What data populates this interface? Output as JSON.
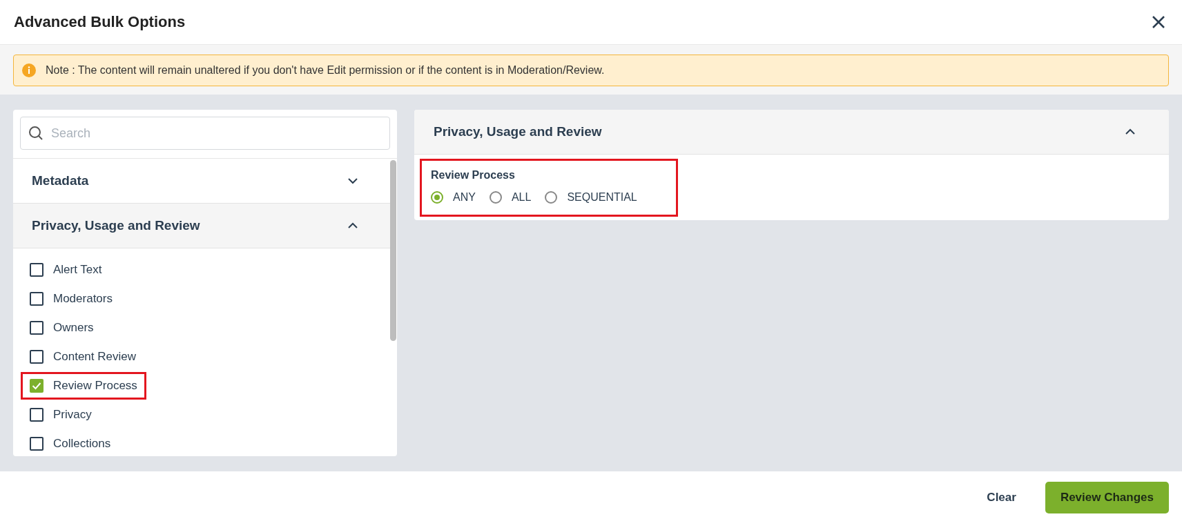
{
  "dialog": {
    "title": "Advanced Bulk Options"
  },
  "note": {
    "text": "Note : The content will remain unaltered if you don't have Edit permission or if the content is in Moderation/Review."
  },
  "search": {
    "placeholder": "Search"
  },
  "sections": [
    {
      "title": "Metadata",
      "expanded": false
    },
    {
      "title": "Privacy, Usage and Review",
      "expanded": true,
      "items": [
        {
          "label": "Alert Text",
          "checked": false,
          "highlighted": false
        },
        {
          "label": "Moderators",
          "checked": false,
          "highlighted": false
        },
        {
          "label": "Owners",
          "checked": false,
          "highlighted": false
        },
        {
          "label": "Content Review",
          "checked": false,
          "highlighted": false
        },
        {
          "label": "Review Process",
          "checked": true,
          "highlighted": true
        },
        {
          "label": "Privacy",
          "checked": false,
          "highlighted": false
        },
        {
          "label": "Collections",
          "checked": false,
          "highlighted": false
        }
      ]
    }
  ],
  "detail": {
    "title": "Privacy, Usage and Review",
    "expanded": true,
    "field": {
      "label": "Review Process",
      "highlighted": true,
      "options": [
        {
          "label": "ANY",
          "selected": true
        },
        {
          "label": "ALL",
          "selected": false
        },
        {
          "label": "SEQUENTIAL",
          "selected": false
        }
      ]
    }
  },
  "footer": {
    "buttons": [
      {
        "label": "Clear",
        "kind": "text"
      },
      {
        "label": "Review Changes",
        "kind": "primary"
      }
    ]
  }
}
